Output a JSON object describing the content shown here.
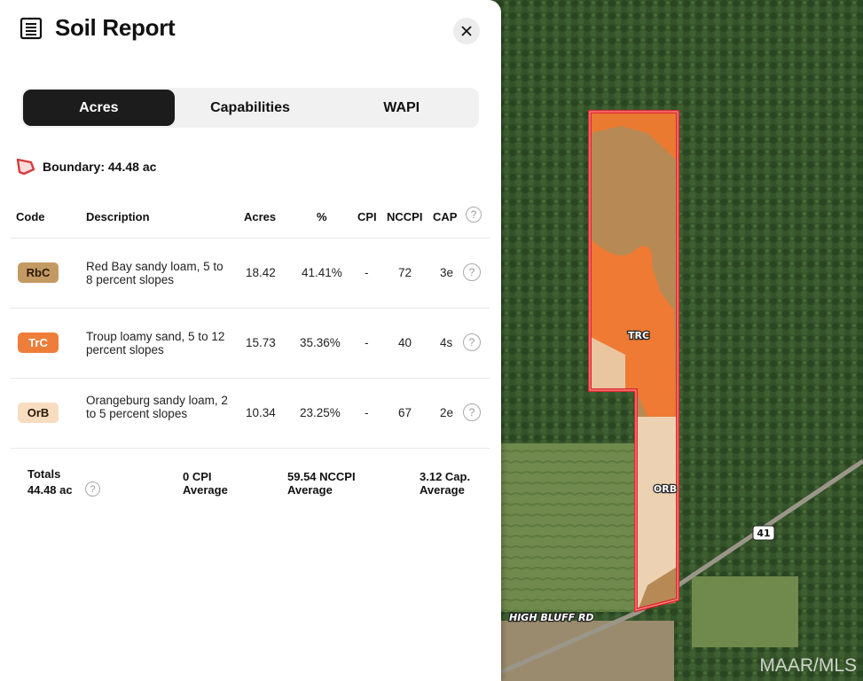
{
  "panel": {
    "title": "Soil Report",
    "tabs": [
      {
        "label": "Acres",
        "active": true
      },
      {
        "label": "Capabilities",
        "active": false
      },
      {
        "label": "WAPI",
        "active": false
      }
    ],
    "boundary_label": "Boundary: 44.48 ac",
    "columns": [
      "Code",
      "Description",
      "Acres",
      "%",
      "CPI",
      "NCCPI",
      "CAP"
    ],
    "rows": [
      {
        "code": "RbC",
        "description": "Red Bay sandy loam, 5 to 8 percent slopes",
        "acres": "18.42",
        "percent": "41.41%",
        "cpi": "-",
        "nccpi": "72",
        "cap": "3e",
        "color": "#c49a64"
      },
      {
        "code": "TrC",
        "description": "Troup loamy sand, 5 to 12 percent slopes",
        "acres": "15.73",
        "percent": "35.36%",
        "cpi": "-",
        "nccpi": "40",
        "cap": "4s",
        "color": "#ee7d3a"
      },
      {
        "code": "OrB",
        "description": "Orangeburg sandy loam, 2 to 5 percent slopes",
        "acres": "10.34",
        "percent": "23.25%",
        "cpi": "-",
        "nccpi": "67",
        "cap": "2e",
        "color": "#f8dcc0"
      }
    ],
    "totals": {
      "label": "Totals",
      "acres": "44.48 ac",
      "cpi_line1": "0 CPI",
      "cpi_line2": "Average",
      "nccpi_line1": "59.54 NCCPI",
      "nccpi_line2": "Average",
      "cap_line1": "3.12 Cap.",
      "cap_line2": "Average"
    }
  },
  "map": {
    "labels": {
      "trc": "TRC",
      "orb": "ORB",
      "road": "HIGH BLUFF RD",
      "route": "41"
    },
    "watermark": "MAAR/MLS"
  },
  "colors": {
    "boundary": "#e0262a",
    "accent_dark": "#1c1c1c"
  }
}
